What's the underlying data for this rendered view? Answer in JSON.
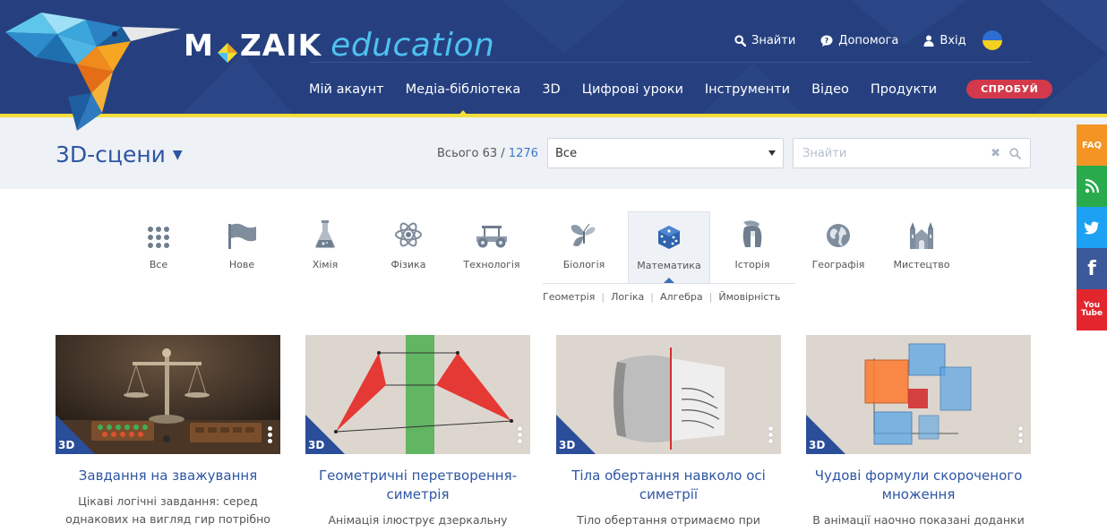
{
  "header": {
    "logo_main_left": "M",
    "logo_main_right": "ZAIK",
    "logo_sub": "education",
    "top_links": {
      "search": "Знайти",
      "help": "Допомога",
      "login": "Вхід"
    },
    "nav": [
      "Мій акаунт",
      "Медіа-бібліотека",
      "3D",
      "Цифрові уроки",
      "Інструменти",
      "Відео",
      "Продукти"
    ],
    "nav_active_index": 1,
    "try_button": "СПРОБУЙ"
  },
  "filter": {
    "title": "3D-сцени",
    "total_label": "Всього 63 / ",
    "total_all": "1276",
    "select_value": "Все",
    "search_placeholder": "Знайти"
  },
  "social": {
    "faq": "FAQ",
    "youtube_top": "You",
    "youtube_bottom": "Tube"
  },
  "categories": [
    {
      "label": "Все",
      "icon": "grid-icon"
    },
    {
      "label": "Нове",
      "icon": "flag-icon"
    },
    {
      "label": "Хімія",
      "icon": "flask-icon"
    },
    {
      "label": "Фізика",
      "icon": "atom-icon"
    },
    {
      "label": "Технологія",
      "icon": "car-icon"
    },
    {
      "label": "Біологія",
      "icon": "butterfly-icon"
    },
    {
      "label": "Математика",
      "icon": "dice-icon"
    },
    {
      "label": "Історія",
      "icon": "helmet-icon"
    },
    {
      "label": "Географія",
      "icon": "globe-icon"
    },
    {
      "label": "Мистецтво",
      "icon": "cathedral-icon"
    }
  ],
  "active_category": 6,
  "subcategories": [
    "Геометрія",
    "Логіка",
    "Алгебра",
    "Ймовірність"
  ],
  "badge": "3D",
  "cards": [
    {
      "title": "Завдання на зважування",
      "desc": "Цікаві логічні завдання: серед однакових на вигляд гир потрібно"
    },
    {
      "title": "Геометричні перетворення-симетрія",
      "desc": "Анімація ілюструє дзеркальну"
    },
    {
      "title": "Тіла обертання навколо осі симетрії",
      "desc": "Тіло обертання отримаємо при"
    },
    {
      "title": "Чудові формули скороченого множення",
      "desc": "В анімації наочно показані доданки"
    }
  ]
}
